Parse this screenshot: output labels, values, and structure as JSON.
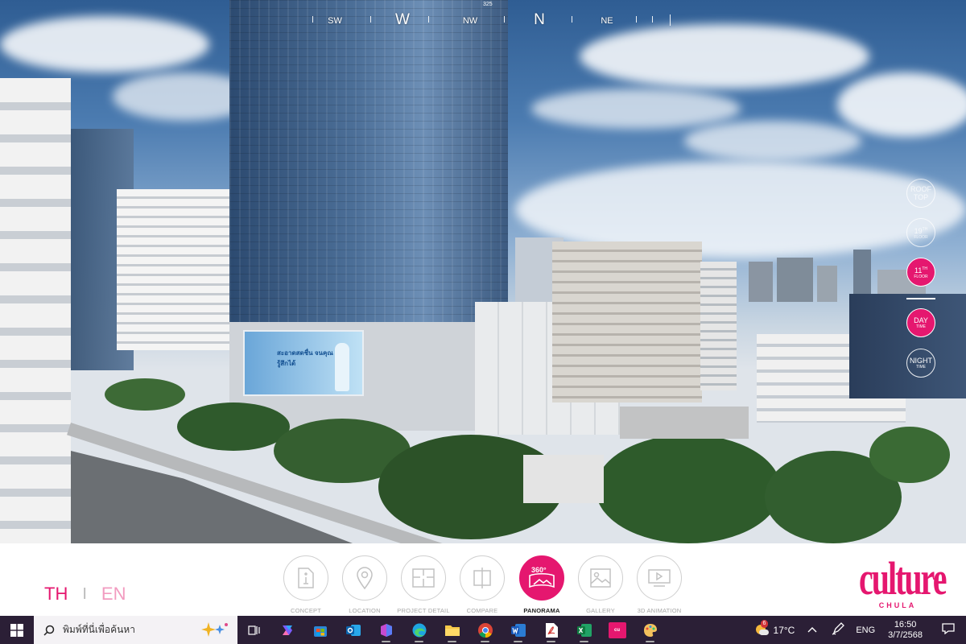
{
  "compass": {
    "degree": "325",
    "labels": [
      "SW",
      "W",
      "NW",
      "N",
      "NE"
    ]
  },
  "billboard": {
    "text": "สะอาดสดชื่น จนคุณรู้สึกได้"
  },
  "right_controls": {
    "rooftop": {
      "line1": "ROOF",
      "line2": "TOP"
    },
    "floor19": {
      "num": "19",
      "sup": "TH",
      "sub": "FLOOR"
    },
    "floor11": {
      "num": "11",
      "sup": "TH",
      "sub": "FLOOR"
    },
    "day": {
      "label": "DAY",
      "sub": "TIME"
    },
    "night": {
      "label": "NIGHT",
      "sub": "TIME"
    },
    "active": [
      "floor11",
      "day"
    ]
  },
  "language": {
    "th": "TH",
    "separator": "I",
    "en": "EN",
    "selected": "TH"
  },
  "nav": [
    {
      "key": "concept",
      "label": "CONCEPT",
      "icon": "concept-document-icon"
    },
    {
      "key": "location",
      "label": "LOCATION",
      "icon": "location-pin-icon"
    },
    {
      "key": "project_detail",
      "label": "PROJECT DETAIL",
      "icon": "floorplan-icon"
    },
    {
      "key": "compare",
      "label": "COMPARE",
      "icon": "compare-icon"
    },
    {
      "key": "panorama",
      "label": "PANORAMA",
      "icon": "panorama-360-icon",
      "badge": "360°",
      "active": true
    },
    {
      "key": "gallery",
      "label": "GALLERY",
      "icon": "gallery-image-icon"
    },
    {
      "key": "animation",
      "label": "3D ANIMATION",
      "icon": "video-play-icon"
    }
  ],
  "logo": {
    "word": "culture",
    "sub": "CHULA"
  },
  "colors": {
    "accent": "#e5176f",
    "taskbar": "#2b1f36"
  },
  "taskbar": {
    "search_placeholder": "พิมพ์ที่นี่เพื่อค้นหา",
    "apps": [
      "task-view",
      "copilot",
      "store",
      "outlook",
      "m365",
      "edge",
      "file-explorer",
      "chrome",
      "word",
      "acrobat",
      "excel",
      "culture-app",
      "paint"
    ],
    "weather_badge": "6",
    "temperature": "17°C",
    "language": "ENG",
    "time": "16:50",
    "date": "3/7/2568"
  }
}
